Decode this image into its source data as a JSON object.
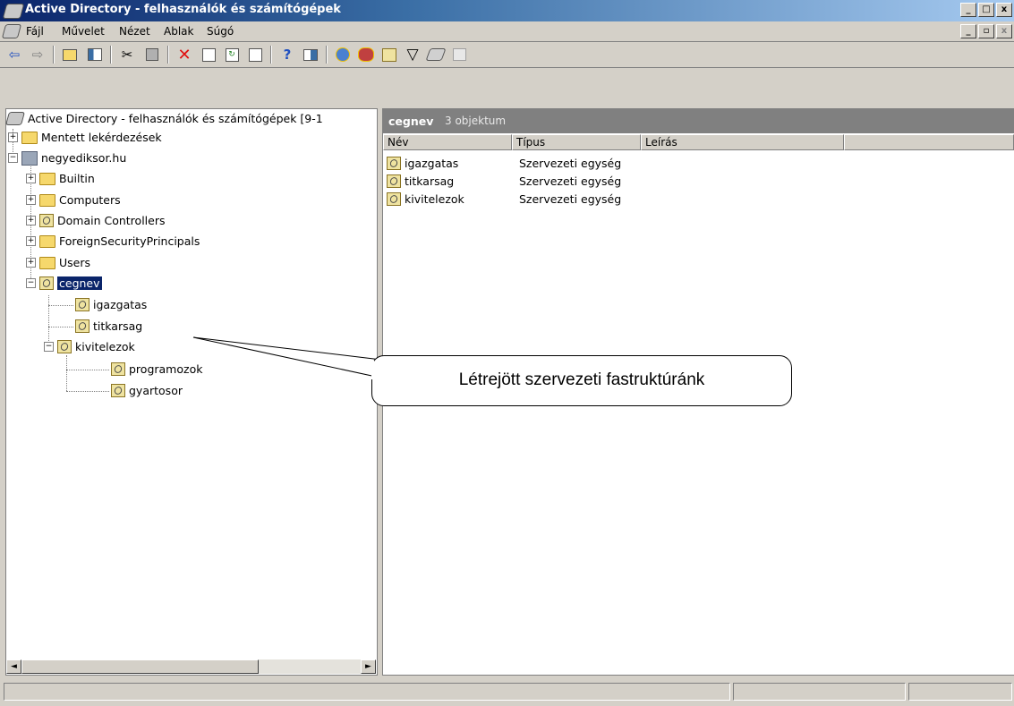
{
  "window": {
    "title": "Active Directory - felhasználók és számítógépek",
    "controls": [
      "_",
      "□",
      "x"
    ]
  },
  "menu": {
    "items": [
      {
        "label": "Fájl",
        "mnemonic": "F"
      },
      {
        "label": "Művelet",
        "mnemonic": "y"
      },
      {
        "label": "Nézet",
        "mnemonic": "N"
      },
      {
        "label": "Ablak",
        "mnemonic": "A"
      },
      {
        "label": "Súgó",
        "mnemonic": "S"
      }
    ],
    "controls": [
      "_",
      "▫",
      "x"
    ]
  },
  "toolbar": {
    "icons": [
      "back-icon",
      "forward-icon",
      "up-folder-icon",
      "show-tree-icon",
      "cut-icon",
      "copy-icon",
      "delete-icon",
      "properties-icon",
      "refresh-icon",
      "export-icon",
      "help-icon",
      "console-icon",
      "new-user-icon",
      "new-group-icon",
      "new-ou-icon",
      "filter-icon",
      "find-icon",
      "add-to-group-icon"
    ]
  },
  "tree": {
    "root": "Active Directory - felhasználók és számítógépek [9-1",
    "saved_queries": "Mentett lekérdezések",
    "domain": "negyediksor.hu",
    "containers": [
      "Builtin",
      "Computers",
      "Domain Controllers",
      "ForeignSecurityPrincipals",
      "Users"
    ],
    "selected": "cegnev",
    "children": [
      "igazgatas",
      "titkarsag",
      "kivitelezok"
    ],
    "sub_children": [
      "programozok",
      "gyartosor"
    ]
  },
  "details": {
    "folder": "cegnev",
    "count": "3 objektum",
    "columns": [
      "Név",
      "Típus",
      "Leírás"
    ],
    "rows": [
      {
        "name": "igazgatas",
        "type": "Szervezeti egység",
        "desc": ""
      },
      {
        "name": "titkarsag",
        "type": "Szervezeti egység",
        "desc": ""
      },
      {
        "name": "kivitelezok",
        "type": "Szervezeti egység",
        "desc": ""
      }
    ]
  },
  "callout": {
    "text": "Létrejött szervezeti fastruktúránk"
  },
  "scroll": {
    "left": "◄",
    "right": "►"
  }
}
